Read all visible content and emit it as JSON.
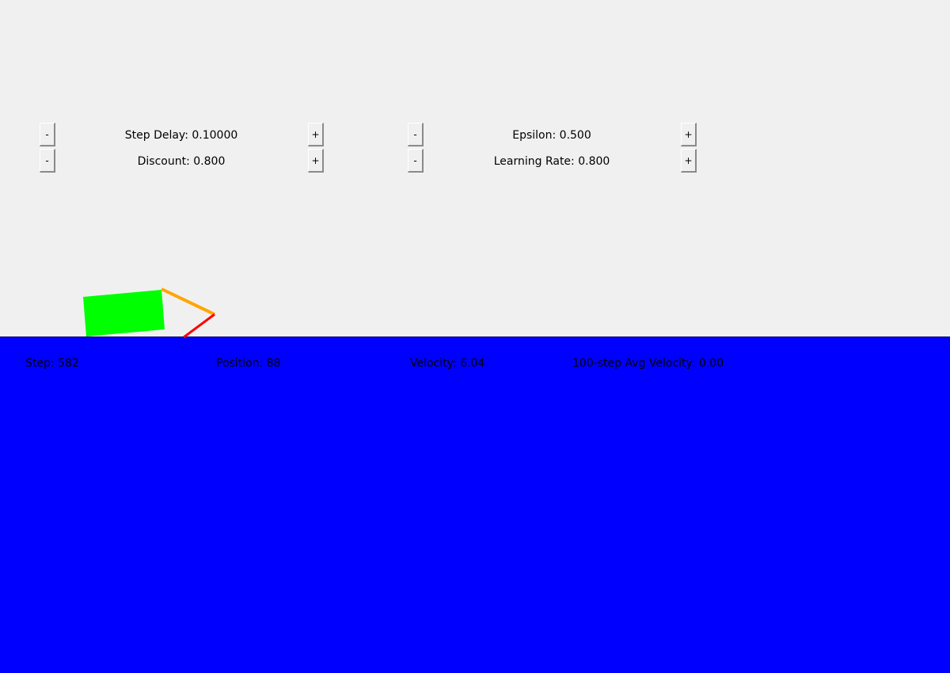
{
  "colors": {
    "panel_bg": "#f0f0f0",
    "ground": "#0000ff",
    "robot_body": "#00ff00",
    "robot_arm": "#ffa500",
    "robot_hand": "#ff0000"
  },
  "controls": {
    "step_delay": {
      "minus": "-",
      "label": "Step Delay: 0.10000",
      "plus": "+"
    },
    "discount": {
      "minus": "-",
      "label": "Discount: 0.800",
      "plus": "+"
    },
    "epsilon": {
      "minus": "-",
      "label": "Epsilon: 0.500",
      "plus": "+"
    },
    "learning_rate": {
      "minus": "-",
      "label": "Learning Rate: 0.800",
      "plus": "+"
    }
  },
  "stats": {
    "step": "Step: 582",
    "position": "Position: 88",
    "velocity": "Velocity: 6.04",
    "avg_velocity": "100-step Avg Velocity: 0.00"
  }
}
